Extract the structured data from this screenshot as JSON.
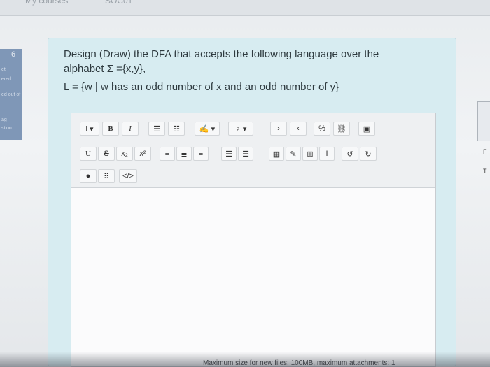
{
  "header": {
    "breadcrumb_left": "My courses",
    "breadcrumb_right": "SOC01"
  },
  "sidebar": {
    "question_number": "6",
    "items": [
      "et",
      "ered",
      "ed out of",
      "ag",
      "stion"
    ]
  },
  "question": {
    "line1": "Design (Draw) the DFA that accepts the following language over the",
    "line2": "alphabet Σ ={x,y},",
    "line3": "L = {w | w has an odd number of x and an odd number of y}"
  },
  "toolbar": {
    "row1": [
      "i ▾",
      "B",
      "I",
      "☰",
      "☷",
      "✍ ▾",
      "♀ ▾",
      "›",
      "‹",
      "%",
      "⛓",
      "▣"
    ],
    "row2": [
      "U",
      "S",
      "x₂",
      "x²",
      "≡",
      "≣",
      "≡",
      "☰",
      "☰",
      "▦",
      "✎",
      "⊞",
      "I",
      "↺",
      "↻"
    ],
    "row3": [
      "●",
      "⠿",
      "</>"
    ]
  },
  "right_edge": {
    "char_top": "F",
    "char_bottom": "T"
  },
  "footer": {
    "text": "Maximum size for new files: 100MB, maximum attachments: 1"
  }
}
